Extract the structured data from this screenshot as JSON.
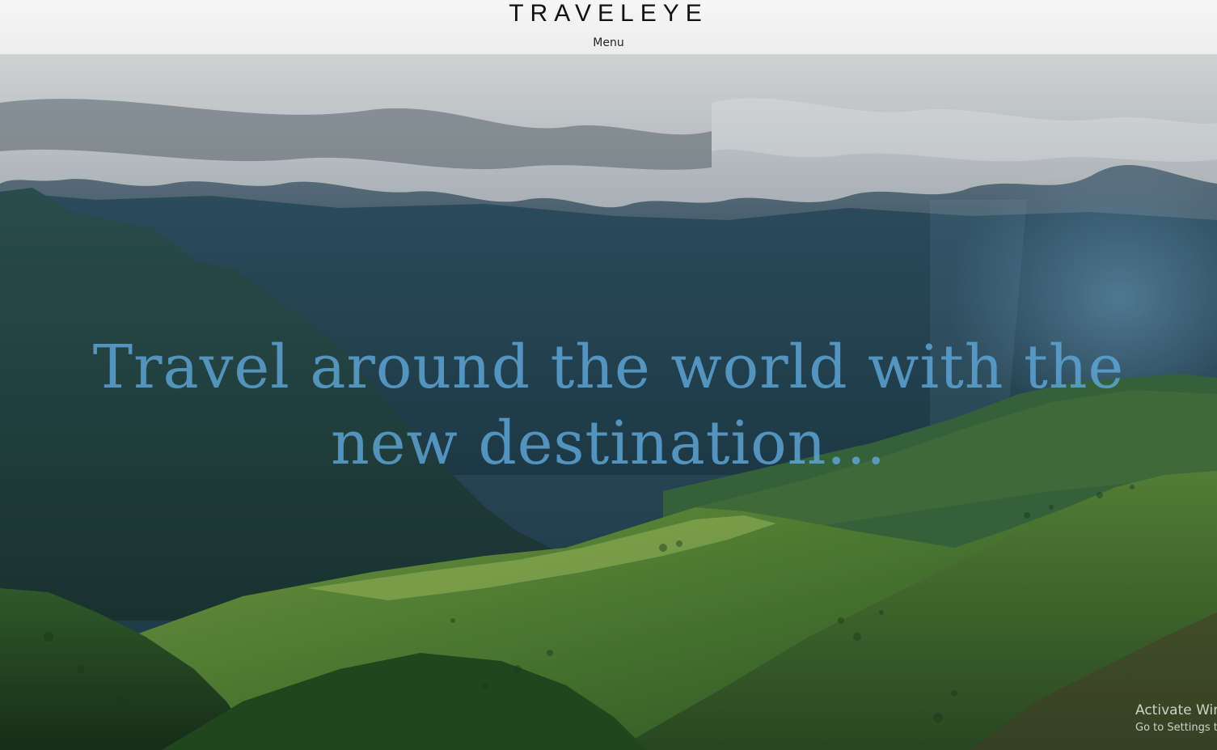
{
  "header": {
    "brand": "TRAVELEYE",
    "menu_label": "Menu"
  },
  "hero": {
    "headline": "Travel around the world with the new destination..."
  },
  "os_watermark": {
    "line1": "Activate Windows",
    "line2": "Go to Settings to activate Windows."
  }
}
